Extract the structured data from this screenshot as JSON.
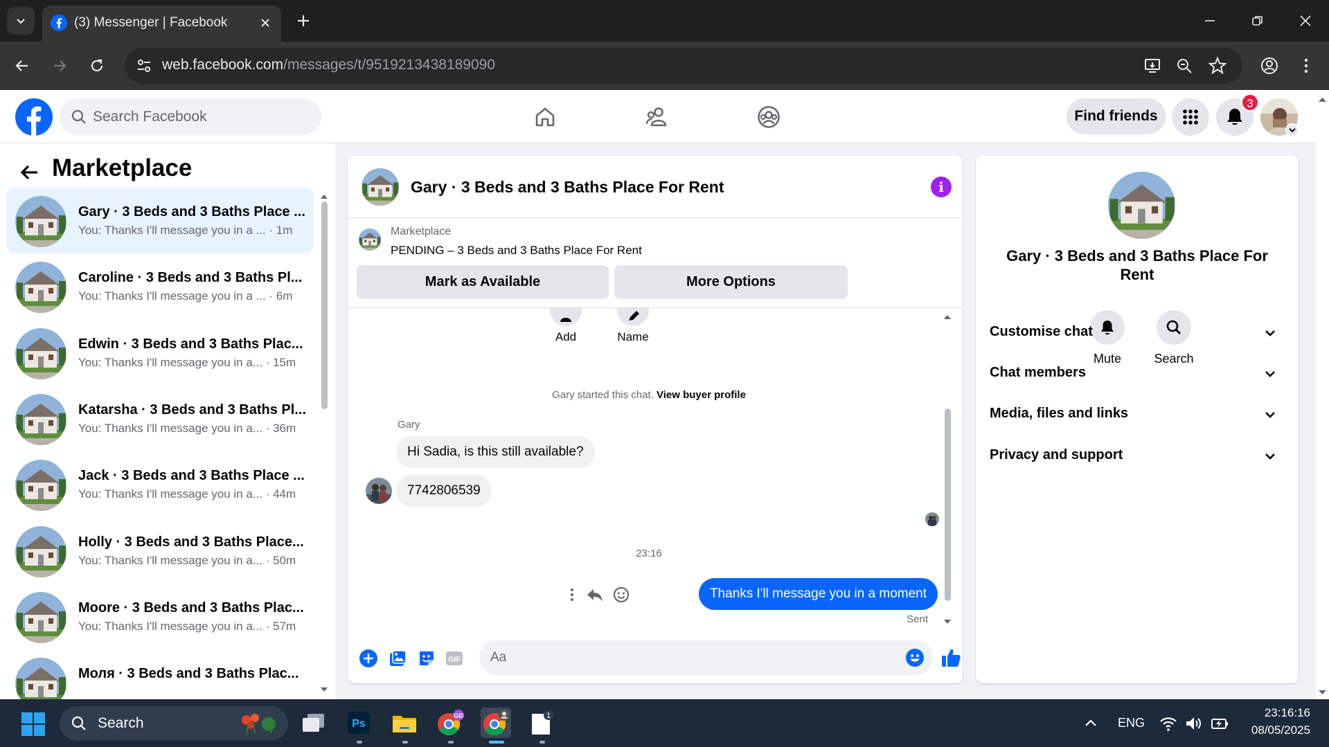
{
  "browser": {
    "tab_title": "(3) Messenger | Facebook",
    "url_host": "web.facebook.com",
    "url_path": "/messages/t/9519213438189090"
  },
  "fb_header": {
    "search_placeholder": "Search Facebook",
    "find_friends_label": "Find friends",
    "notification_count": "3"
  },
  "left_panel": {
    "title": "Marketplace",
    "chats": [
      {
        "name": "Gary · 3 Beds and 3 Baths Place ...",
        "preview": "You: Thanks I'll message you in a ...",
        "time": " · 1m"
      },
      {
        "name": "Caroline · 3 Beds and 3 Baths Pl...",
        "preview": "You: Thanks I'll message you in a ...",
        "time": " · 6m"
      },
      {
        "name": "Edwin · 3 Beds and 3 Baths Plac...",
        "preview": "You: Thanks I'll message you in a...",
        "time": " · 15m"
      },
      {
        "name": "Katarsha · 3 Beds and 3 Baths Pl...",
        "preview": "You: Thanks I'll message you in a...",
        "time": " · 36m"
      },
      {
        "name": "Jack · 3 Beds and 3 Baths Place ...",
        "preview": "You: Thanks I'll message you in a...",
        "time": " · 44m"
      },
      {
        "name": "Holly · 3 Beds and 3 Baths Place...",
        "preview": "You: Thanks I'll message you in a...",
        "time": " · 50m"
      },
      {
        "name": "Moore · 3 Beds and 3 Baths Plac...",
        "preview": "You: Thanks I'll message you in a...",
        "time": " · 57m"
      },
      {
        "name": "Моля · 3 Beds and 3 Baths Plac...",
        "preview": "",
        "time": ""
      }
    ]
  },
  "chat": {
    "title": "Gary · 3 Beds and 3 Baths Place For Rent",
    "listing_label": "Marketplace",
    "listing_status": "PENDING – 3 Beds and 3 Baths Place For Rent",
    "mark_available_label": "Mark as Available",
    "more_options_label": "More Options",
    "quick_actions": [
      "Add",
      "Name"
    ],
    "start_text": "Gary started this chat.",
    "view_profile_label": "View buyer profile",
    "sender": "Gary",
    "incoming": [
      "Hi Sadia, is this still available?",
      "7742806539"
    ],
    "timestamp": "23:16",
    "outgoing": "Thanks I'll message you in a moment",
    "sent_label": "Sent",
    "composer_placeholder": "Aa"
  },
  "info_panel": {
    "name": "Gary · 3 Beds and 3 Baths Place For Rent",
    "actions": [
      "Mute",
      "Search"
    ],
    "rows": [
      "Customise chat",
      "Chat members",
      "Media, files and links",
      "Privacy and support"
    ]
  },
  "taskbar": {
    "search_label": "Search",
    "language": "ENG",
    "time": "23:16:16",
    "date": "08/05/2025"
  },
  "colors": {
    "fb_blue": "#0866ff",
    "info_purple": "#a020f0",
    "active_chat_bg": "#e7f3ff"
  }
}
